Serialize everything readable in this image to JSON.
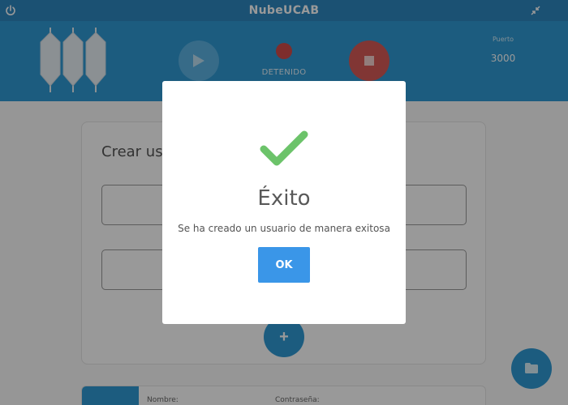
{
  "window": {
    "title": "NubeUCAB",
    "power_icon": "power-icon",
    "shrink_icon": "compress-icon"
  },
  "header": {
    "logo_icon": "server-logo-icon",
    "play_icon": "play-icon",
    "status_label": "DETENIDO",
    "status_color": "#d34c4a",
    "stop_icon": "stop-icon",
    "port_label": "Puerto",
    "port_value": "3000"
  },
  "form": {
    "title": "Crear usuario",
    "add_label": "+"
  },
  "list": {
    "name_label": "Nombre:",
    "password_label": "Contraseña:"
  },
  "fab": {
    "icon": "folder-icon"
  },
  "dialog": {
    "icon": "check-icon",
    "title": "Éxito",
    "message": "Se ha creado un usuario de manera exitosa",
    "ok_label": "OK",
    "accent": "#3a96e8",
    "success_color": "#6cc36a"
  }
}
